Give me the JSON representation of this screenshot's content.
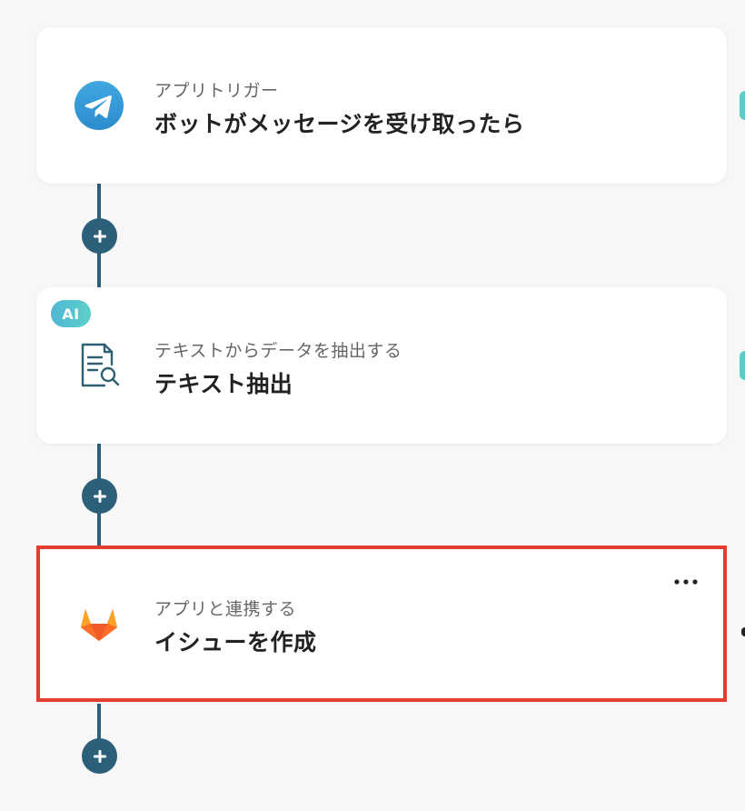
{
  "workflow": {
    "steps": [
      {
        "subtitle": "アプリトリガー",
        "title": "ボットがメッセージを受け取ったら",
        "icon": "telegram-icon"
      },
      {
        "badge": "AI",
        "subtitle": "テキストからデータを抽出する",
        "title": "テキスト抽出",
        "icon": "document-search-icon"
      },
      {
        "subtitle": "アプリと連携する",
        "title": "イシューを作成",
        "icon": "gitlab-icon",
        "selected": true
      }
    ]
  },
  "colors": {
    "connector": "#2b5f7a",
    "selection_border": "#e53d2f",
    "telegram": "#3a9ad9",
    "ai_badge": "#4fb7d4",
    "gitlab_orange": "#e24329"
  }
}
